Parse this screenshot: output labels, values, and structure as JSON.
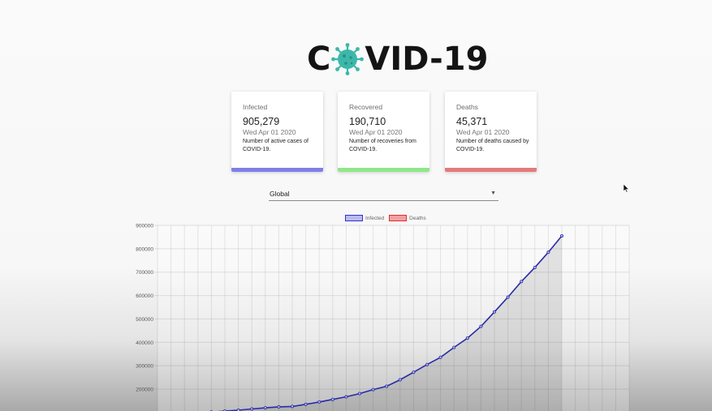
{
  "header": {
    "title_left": "C",
    "title_right": "VID-19"
  },
  "cards": [
    {
      "label": "Infected",
      "value": "905,279",
      "date": "Wed Apr 01 2020",
      "description": "Number of active cases of COVID-19.",
      "color": "#7f7fea"
    },
    {
      "label": "Recovered",
      "value": "190,710",
      "date": "Wed Apr 01 2020",
      "description": "Number of recoveries from COVID-19.",
      "color": "#8fe889"
    },
    {
      "label": "Deaths",
      "value": "45,371",
      "date": "Wed Apr 01 2020",
      "description": "Number of deaths caused by COVID-19.",
      "color": "#e57a7a"
    }
  ],
  "country_select": {
    "value": "Global"
  },
  "legend": {
    "infected": {
      "label": "Infected",
      "border": "#3333cc",
      "fill": "#b9b9f2"
    },
    "deaths": {
      "label": "Deaths",
      "border": "#e03030",
      "fill": "#f0a0a0"
    }
  },
  "chart_data": {
    "type": "line",
    "ylim": [
      100000,
      900000
    ],
    "y_ticks": [
      "900000",
      "800000",
      "700000",
      "600000",
      "500000",
      "400000",
      "300000",
      "200000"
    ],
    "grid": true,
    "legend_position": "top",
    "x_count": 35,
    "series": [
      {
        "name": "Infected",
        "color": "#2a2aa8",
        "points": [
          [
            1,
            94000
          ],
          [
            2,
            96000
          ],
          [
            3,
            99000
          ],
          [
            4,
            102000
          ],
          [
            5,
            106000
          ],
          [
            6,
            110000
          ],
          [
            7,
            115000
          ],
          [
            8,
            120000
          ],
          [
            9,
            124000
          ],
          [
            10,
            126000
          ],
          [
            11,
            135000
          ],
          [
            12,
            145000
          ],
          [
            13,
            156000
          ],
          [
            14,
            167000
          ],
          [
            15,
            181000
          ],
          [
            16,
            198000
          ],
          [
            17,
            212000
          ],
          [
            18,
            240000
          ],
          [
            19,
            272000
          ],
          [
            20,
            305000
          ],
          [
            21,
            336000
          ],
          [
            22,
            378000
          ],
          [
            23,
            418000
          ],
          [
            24,
            468000
          ],
          [
            25,
            530000
          ],
          [
            26,
            593000
          ],
          [
            27,
            660000
          ],
          [
            28,
            720000
          ],
          [
            29,
            785000
          ],
          [
            30,
            855000
          ]
        ]
      }
    ]
  }
}
